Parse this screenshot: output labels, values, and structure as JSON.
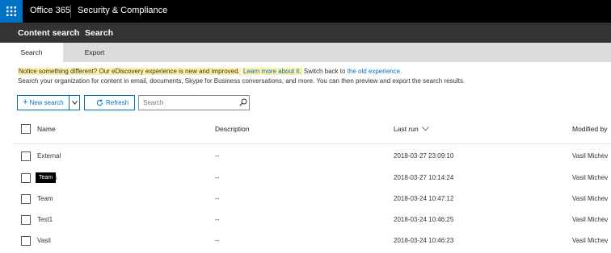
{
  "suite": {
    "brand": "Office 365",
    "app": "Security & Compliance",
    "waffle_icon": "app-launcher-icon",
    "brand_color": "#0072c6"
  },
  "breadcrumb": {
    "parent": "Content search",
    "current": "Search"
  },
  "tabs": [
    {
      "label": "Search",
      "active": true
    },
    {
      "label": "Export",
      "active": false
    }
  ],
  "notice": {
    "highlight": "Notice something different? Our eDiscovery experience is new and improved.",
    "learn_more": "Learn more about it.",
    "switch_text": "Switch back to",
    "old_link": "the old experience."
  },
  "intro": "Search your organization for content in email, documents, Skype for Business conversations, and more. You can then preview and export the search results.",
  "toolbar": {
    "new_search": "New search",
    "refresh": "Refresh",
    "search_placeholder": "Search"
  },
  "table": {
    "columns": {
      "name": "Name",
      "description": "Description",
      "last_run": "Last run",
      "modified_by": "Modified by"
    },
    "sort_icon": "chevron-down-icon",
    "rows": [
      {
        "name": "External",
        "description": "--",
        "last_run": "2018-03-27 23:09:10",
        "modified_by": "Vasil Michev"
      },
      {
        "name": "ass",
        "description": "--",
        "last_run": "2018-03-27 10:14:24",
        "modified_by": "Vasil Michev"
      },
      {
        "name": "Team",
        "description": "--",
        "last_run": "2018-03-24 10:47:12",
        "modified_by": "Vasil Michev"
      },
      {
        "name": "Test1",
        "description": "--",
        "last_run": "2018-03-24 10:46:25",
        "modified_by": "Vasil Michev"
      },
      {
        "name": "Vasil",
        "description": "--",
        "last_run": "2018-03-24 10:46:23",
        "modified_by": "Vasil Michev"
      }
    ],
    "tooltip": "Team"
  }
}
